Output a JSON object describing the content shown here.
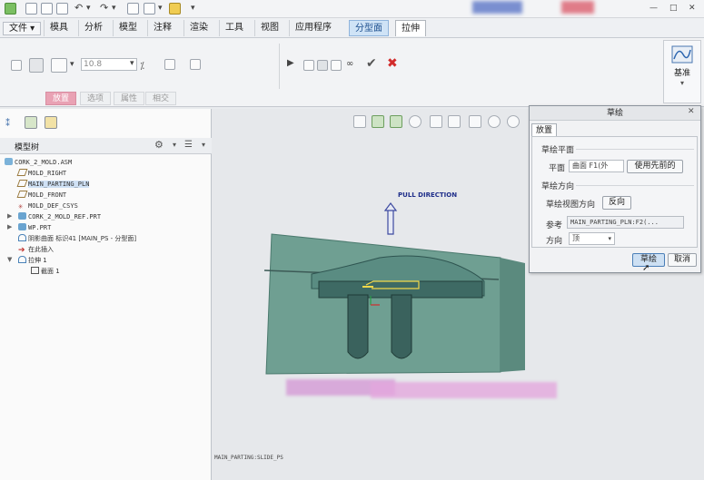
{
  "quick_access": {
    "title_text": "",
    "icons": [
      "app-icon",
      "new-icon",
      "open-icon",
      "save-icon",
      "undo-icon",
      "redo-icon",
      "regenerate-icon",
      "window-icon",
      "folder-icon"
    ]
  },
  "menu": {
    "file": "文件",
    "tabs": [
      "模具",
      "分析",
      "模型",
      "注释",
      "渲染",
      "工具",
      "视图",
      "应用程序"
    ],
    "active_tab": "分型面",
    "current_tab": "拉伸"
  },
  "ribbon": {
    "thickness_value": "10.8",
    "tabs": [
      "放置",
      "选项",
      "属性",
      "相交"
    ],
    "active_tab_index": 0,
    "datum_label": "基准"
  },
  "tree": {
    "title": "模型树",
    "items": [
      {
        "label": "CORK_2_MOLD.ASM",
        "icon": "assembly-icon",
        "level": 0
      },
      {
        "label": "MOLD_RIGHT",
        "icon": "datum-plane-icon",
        "level": 1
      },
      {
        "label": "MAIN_PARTING_PLN",
        "icon": "datum-plane-icon",
        "level": 1,
        "selected": true
      },
      {
        "label": "MOLD_FRONT",
        "icon": "datum-plane-icon",
        "level": 1
      },
      {
        "label": "MOLD_DEF_CSYS",
        "icon": "csys-icon",
        "level": 1
      },
      {
        "label": "CORK_2_MOLD_REF.PRT",
        "icon": "part-icon",
        "level": 1,
        "expandable": true
      },
      {
        "label": "WP.PRT",
        "icon": "part-icon",
        "level": 1,
        "expandable": true
      },
      {
        "label": "阴影曲面 标识41 [MAIN_PS - 分型面]",
        "icon": "surface-icon",
        "level": 1
      },
      {
        "label": "在此插入",
        "icon": "insert-arrow-icon",
        "level": 1
      },
      {
        "label": "拉伸 1",
        "icon": "extrude-icon",
        "level": 1,
        "expandable": true
      },
      {
        "label": "截面 1",
        "icon": "sketch-icon",
        "level": 2
      }
    ]
  },
  "graphics": {
    "pull_direction_label": "PULL DIRECTION",
    "status_label": "MAIN_PARTING:SLIDE_PS"
  },
  "dialog": {
    "title": "草绘",
    "tab": "放置",
    "sketch_plane_group": "草绘平面",
    "plane_label": "平面",
    "plane_value": "曲面 F1(外",
    "use_previous_button": "使用先前的",
    "orientation_group": "草绘方向",
    "view_direction_label": "草绘视图方向",
    "flip_button": "反向",
    "reference_label": "参考",
    "reference_value": "MAIN_PARTING_PLN:F2(...",
    "direction_label": "方向",
    "direction_value": "顶",
    "sketch_button": "草绘",
    "cancel_button": "取消"
  },
  "colors": {
    "mold_body": "#6f9f92",
    "mold_dark": "#2e5450",
    "accent_red": "#d22b2b",
    "active_tab_blue": "#cfe3f6",
    "ribbon_tab_pink": "#e9a2b4"
  }
}
